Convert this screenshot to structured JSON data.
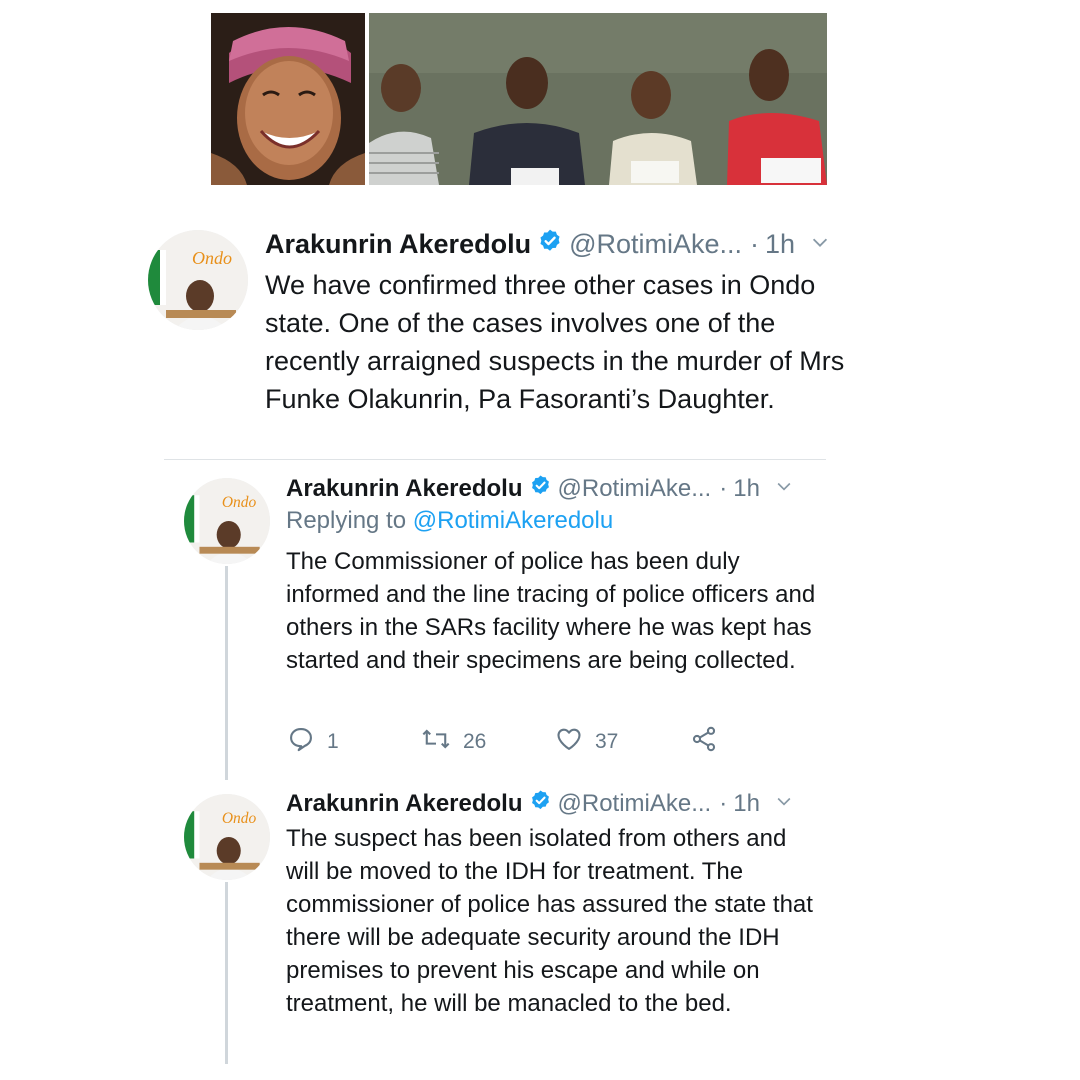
{
  "photos": {
    "left_alt": "woman-portrait",
    "right_alt": "four-suspects-photo"
  },
  "colors": {
    "verified_blue": "#1da1f2",
    "secondary_text": "#657786",
    "primary_text": "#14171a",
    "thread_line": "#d0d6db"
  },
  "tweets": [
    {
      "author_name": "Arakunrin Akeredolu",
      "handle": "@RotimiAke...",
      "dot": "·",
      "time": "1h",
      "text": "We have confirmed three other cases in Ondo state. One of the cases involves one of the recently arraigned suspects in the murder of Mrs Funke Olakunrin, Pa Fasoranti’s Daughter."
    },
    {
      "author_name": "Arakunrin Akeredolu",
      "handle": "@RotimiAke...",
      "dot": "·",
      "time": "1h",
      "replying_label": "Replying to",
      "replying_to": "@RotimiAkeredolu",
      "text": "The Commissioner of police has been duly informed and the line tracing of police officers and others in the SARs facility where he was kept has started and their specimens are being collected.",
      "actions": {
        "replies": "1",
        "retweets": "26",
        "likes": "37"
      }
    },
    {
      "author_name": "Arakunrin Akeredolu",
      "handle": "@RotimiAke...",
      "dot": "·",
      "time": "1h",
      "text": "The suspect has been isolated from others and will be moved to the IDH for treatment. The commissioner of police has assured the state that there will be adequate security around the IDH premises to prevent his escape and while on treatment, he will be manacled to the bed."
    }
  ],
  "avatar_logo_text": "Ondo",
  "icons": {
    "verified": "verified-badge-icon",
    "chevron": "chevron-down-icon",
    "reply": "reply-icon",
    "retweet": "retweet-icon",
    "like": "heart-icon",
    "share": "share-icon"
  }
}
